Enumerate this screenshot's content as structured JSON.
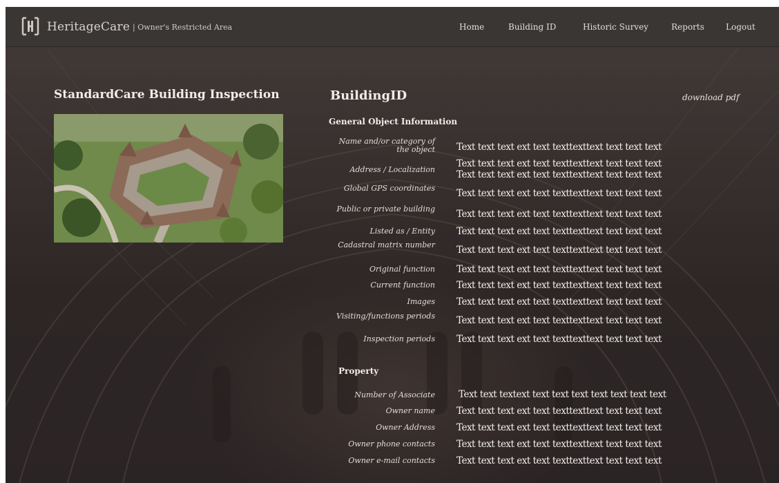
{
  "header": {
    "brand": "HeritageCare",
    "subtitle": "| Owner's Restricted Area",
    "nav": [
      {
        "label": "Home"
      },
      {
        "label": "Building ID"
      },
      {
        "label": "Historic Survey"
      },
      {
        "label": "Reports"
      },
      {
        "label": "Logout"
      }
    ]
  },
  "inspection": {
    "title": "StandardCare Building Inspection"
  },
  "building_id": {
    "title": "BuildingID",
    "download": "download pdf",
    "general_title": "General Object Information",
    "general_fields": [
      {
        "label": "Name and/or category of the object",
        "value": "Text text text ext text texttexttext text text text"
      },
      {
        "label": "Address / Localization",
        "value": "Text text text ext text texttexttext text text text",
        "value2": "Text text text ext text texttexttext text text text"
      },
      {
        "label": "Global GPS coordinates",
        "value": "Text text text ext text texttexttext text text text"
      },
      {
        "label": "Public or private building",
        "value": "Text text text ext text texttexttext text text text"
      },
      {
        "label": "Listed as / Entity",
        "value": "Text text text ext text texttexttext text text text"
      },
      {
        "label": "Cadastral matrix number",
        "value": "Text text text ext text texttexttext text text text"
      },
      {
        "label": "Original function",
        "value": "Text text text ext text texttexttext text text text"
      },
      {
        "label": "Current function",
        "value": "Text text text ext text texttexttext text text text"
      },
      {
        "label": "Images",
        "value": "Text text text ext text texttexttext text text text"
      },
      {
        "label": "Visiting/functions periods",
        "value": "Text text text ext text texttexttext text text text"
      },
      {
        "label": "Inspection periods",
        "value": "Text text text ext text texttexttext text text text"
      }
    ],
    "property_title": "Property",
    "property_fields": [
      {
        "label": "Number of Associate",
        "value": "Text text textext text text text text text text text"
      },
      {
        "label": "Owner name",
        "value": "Text text text ext text texttexttext text text text"
      },
      {
        "label": "Owner Address",
        "value": "Text text text ext text texttexttext text text text"
      },
      {
        "label": "Owner phone contacts",
        "value": "Text text text ext text texttexttext text text text"
      },
      {
        "label": "Owner e-mail contacts",
        "value": "Text text text ext text texttexttext text text text"
      }
    ]
  },
  "colors": {
    "header_bg": "#3a3634",
    "text_light": "#f1ede8"
  }
}
